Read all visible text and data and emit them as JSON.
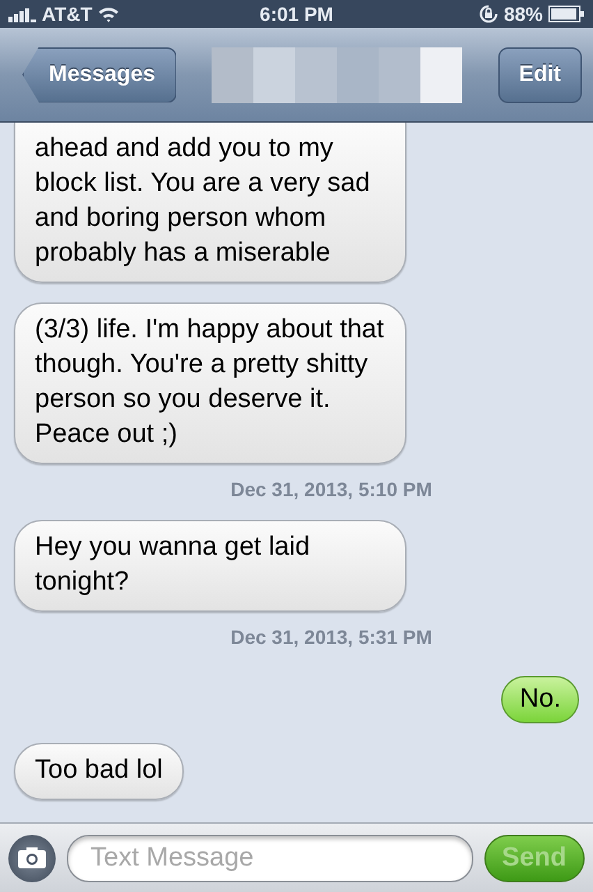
{
  "status_bar": {
    "carrier": "AT&T",
    "time": "6:01 PM",
    "battery": "88%"
  },
  "nav_bar": {
    "back": "Messages",
    "edit": "Edit"
  },
  "messages": [
    {
      "kind": "incoming",
      "text": "ahead and add you to my block list. You are a very sad and boring person whom probably has a miserable",
      "clipped": true
    },
    {
      "kind": "incoming",
      "text": "(3/3) life. I'm happy about that though. You're a pretty shitty person so you deserve it. Peace out ;)",
      "clipped": false
    },
    {
      "kind": "timestamp",
      "text": "Dec 31, 2013, 5:10 PM"
    },
    {
      "kind": "incoming",
      "text": "Hey you wanna get laid tonight?",
      "clipped": false
    },
    {
      "kind": "timestamp",
      "text": "Dec 31, 2013, 5:31 PM"
    },
    {
      "kind": "outgoing",
      "text": "No.",
      "clipped": false
    },
    {
      "kind": "incoming",
      "text": "Too bad lol",
      "clipped": false
    }
  ],
  "compose": {
    "placeholder": "Text Message",
    "send": "Send",
    "send_disabled": true
  }
}
